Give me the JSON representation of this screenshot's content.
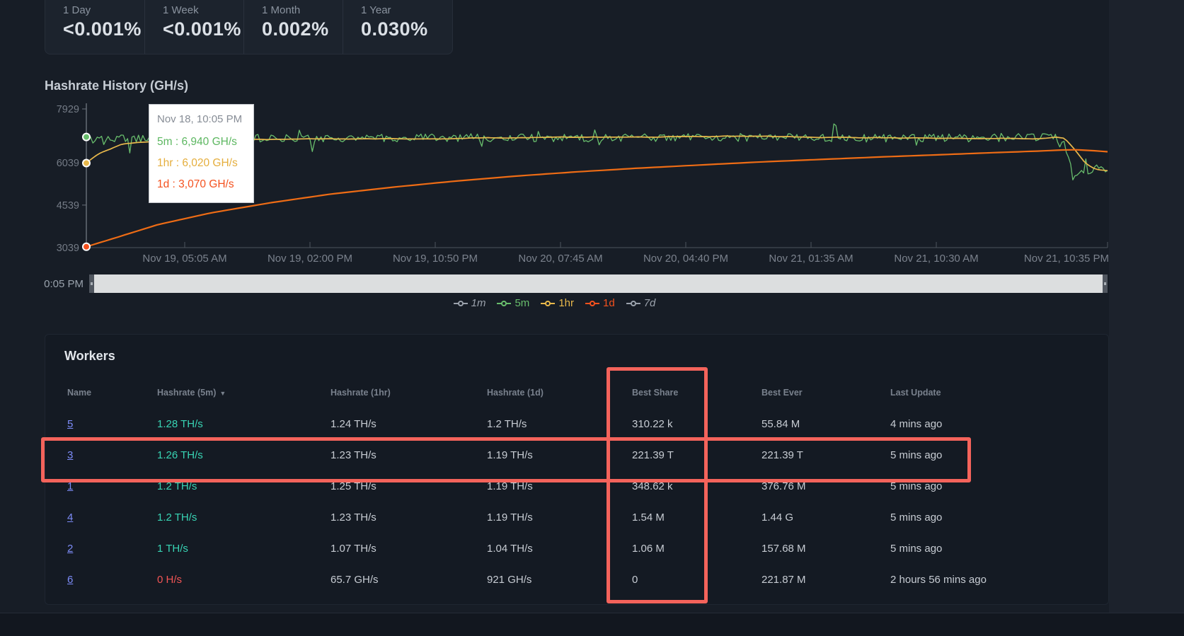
{
  "stats": {
    "cards": [
      {
        "label": "1 Day",
        "value": "<0.001%"
      },
      {
        "label": "1 Week",
        "value": "<0.001%"
      },
      {
        "label": "1 Month",
        "value": "0.002%"
      },
      {
        "label": "1 Year",
        "value": "0.030%"
      }
    ]
  },
  "chart": {
    "title": "Hashrate History (GH/s)",
    "tooltip": {
      "date": "Nov 18, 10:05 PM",
      "separator": " : ",
      "rows": [
        {
          "label": "5m",
          "value": "6,940 GH/s",
          "color": "#5db761"
        },
        {
          "label": "1hr",
          "value": "6,020 GH/s",
          "color": "#e5ae3d"
        },
        {
          "label": "1d",
          "value": "3,070 GH/s",
          "color": "#f4511e"
        }
      ]
    },
    "slider_label": "0:05 PM",
    "legend": [
      {
        "label": "1m",
        "color": "#9aa1ab",
        "disabled": true
      },
      {
        "label": "5m",
        "color": "#68bd6c",
        "disabled": false
      },
      {
        "label": "1hr",
        "color": "#e8b84b",
        "disabled": false
      },
      {
        "label": "1d",
        "color": "#f4511e",
        "disabled": false
      },
      {
        "label": "7d",
        "color": "#9aa1ab",
        "disabled": true
      }
    ]
  },
  "chart_data": {
    "type": "line",
    "title": "Hashrate History (GH/s)",
    "ylabel": "GH/s",
    "y_ticks": [
      3039,
      4539,
      6039,
      7929
    ],
    "y_range": [
      3039,
      7929
    ],
    "x_tick_labels": [
      "Nov 19, 05:05 AM",
      "Nov 19, 02:00 PM",
      "Nov 19, 10:50 PM",
      "Nov 20, 07:45 AM",
      "Nov 20, 04:40 PM",
      "Nov 21, 01:35 AM",
      "Nov 21, 10:30 AM",
      "Nov 21, 10:35 PM"
    ],
    "grid": false,
    "legend_position": "bottom",
    "disabled_series": [
      "1m",
      "7d"
    ],
    "series": [
      {
        "name": "5m",
        "color": "#68bd6c",
        "accent": "#68bd6c",
        "samples": 470,
        "points": [
          [
            0,
            6940
          ],
          [
            0.006,
            6860
          ],
          [
            0.08,
            6910
          ],
          [
            0.2,
            6890
          ],
          [
            0.35,
            6920
          ],
          [
            0.5,
            6900
          ],
          [
            0.62,
            6930
          ],
          [
            0.75,
            6900
          ],
          [
            0.88,
            6910
          ],
          [
            0.945,
            6930
          ],
          [
            0.956,
            6850
          ],
          [
            0.962,
            6250
          ],
          [
            0.968,
            5550
          ],
          [
            0.975,
            5800
          ],
          [
            0.982,
            5600
          ],
          [
            0.99,
            5900
          ],
          [
            1,
            5680
          ]
        ],
        "noise_amp": [
          [
            0,
            140
          ],
          [
            0.95,
            140
          ],
          [
            0.962,
            90
          ],
          [
            1,
            90
          ]
        ],
        "spike_p": 0.055,
        "spike": 1100
      },
      {
        "name": "1hr",
        "color": "#e8b84b",
        "accent": "#e8b84b",
        "samples": 300,
        "smooth": 0.85,
        "points": [
          [
            0,
            6020
          ],
          [
            0.012,
            6350
          ],
          [
            0.035,
            6680
          ],
          [
            0.07,
            6810
          ],
          [
            0.13,
            6860
          ],
          [
            0.22,
            6870
          ],
          [
            0.33,
            6890
          ],
          [
            0.45,
            6920
          ],
          [
            0.56,
            6950
          ],
          [
            0.66,
            6960
          ],
          [
            0.76,
            6920
          ],
          [
            0.86,
            6890
          ],
          [
            0.93,
            6890
          ],
          [
            0.95,
            6930
          ],
          [
            0.958,
            6880
          ],
          [
            0.968,
            6500
          ],
          [
            0.978,
            6050
          ],
          [
            0.988,
            5820
          ],
          [
            1,
            5760
          ]
        ],
        "noise_amp": [
          [
            0,
            25
          ],
          [
            1,
            25
          ]
        ]
      },
      {
        "name": "1d",
        "color": "#ee6c15",
        "accent": "#f4511e",
        "samples": 160,
        "points": [
          [
            0,
            3070
          ],
          [
            0.03,
            3400
          ],
          [
            0.07,
            3850
          ],
          [
            0.12,
            4250
          ],
          [
            0.18,
            4620
          ],
          [
            0.24,
            4930
          ],
          [
            0.3,
            5170
          ],
          [
            0.36,
            5380
          ],
          [
            0.42,
            5560
          ],
          [
            0.48,
            5710
          ],
          [
            0.54,
            5840
          ],
          [
            0.6,
            5950
          ],
          [
            0.66,
            6060
          ],
          [
            0.72,
            6150
          ],
          [
            0.78,
            6240
          ],
          [
            0.84,
            6320
          ],
          [
            0.89,
            6390
          ],
          [
            0.93,
            6440
          ],
          [
            0.955,
            6480
          ],
          [
            0.97,
            6490
          ],
          [
            0.985,
            6460
          ],
          [
            1,
            6420
          ]
        ]
      }
    ],
    "hover": {
      "date": "Nov 18, 10:05 PM",
      "points": [
        {
          "series": "5m",
          "value": 6940
        },
        {
          "series": "1hr",
          "value": 6020
        },
        {
          "series": "1d",
          "value": 3070
        }
      ]
    }
  },
  "workers": {
    "title": "Workers",
    "sort_indicator": "▼",
    "columns": [
      {
        "label": "Name"
      },
      {
        "label": "Hashrate (5m)",
        "sorted": true
      },
      {
        "label": "Hashrate (1hr)"
      },
      {
        "label": "Hashrate (1d)"
      },
      {
        "label": "Best Share"
      },
      {
        "label": "Best Ever"
      },
      {
        "label": "Last Update"
      }
    ],
    "rows": [
      {
        "name": "5",
        "h5m": "1.28 TH/s",
        "h1hr": "1.24 TH/s",
        "h1d": "1.2 TH/s",
        "best_share": "310.22 k",
        "best_ever": "55.84 M",
        "last_update": "4 mins ago"
      },
      {
        "name": "3",
        "h5m": "1.26 TH/s",
        "h1hr": "1.23 TH/s",
        "h1d": "1.19 TH/s",
        "best_share": "221.39 T",
        "best_ever": "221.39 T",
        "last_update": "5 mins ago"
      },
      {
        "name": "1",
        "h5m": "1.2 TH/s",
        "h1hr": "1.25 TH/s",
        "h1d": "1.19 TH/s",
        "best_share": "348.62 k",
        "best_ever": "376.76 M",
        "last_update": "5 mins ago"
      },
      {
        "name": "4",
        "h5m": "1.2 TH/s",
        "h1hr": "1.23 TH/s",
        "h1d": "1.19 TH/s",
        "best_share": "1.54 M",
        "best_ever": "1.44 G",
        "last_update": "5 mins ago"
      },
      {
        "name": "2",
        "h5m": "1 TH/s",
        "h1hr": "1.07 TH/s",
        "h1d": "1.04 TH/s",
        "best_share": "1.06 M",
        "best_ever": "157.68 M",
        "last_update": "5 mins ago"
      },
      {
        "name": "6",
        "h5m": "0 H/s",
        "h5m_alert": true,
        "h1hr": "65.7 GH/s",
        "h1d": "921 GH/s",
        "best_share": "0",
        "best_ever": "221.87 M",
        "last_update": "2 hours 56 mins ago"
      }
    ]
  },
  "annotations": {
    "color": "#f4635b",
    "boxes": [
      {
        "name": "best-share-column"
      },
      {
        "name": "worker-3-row"
      }
    ]
  }
}
